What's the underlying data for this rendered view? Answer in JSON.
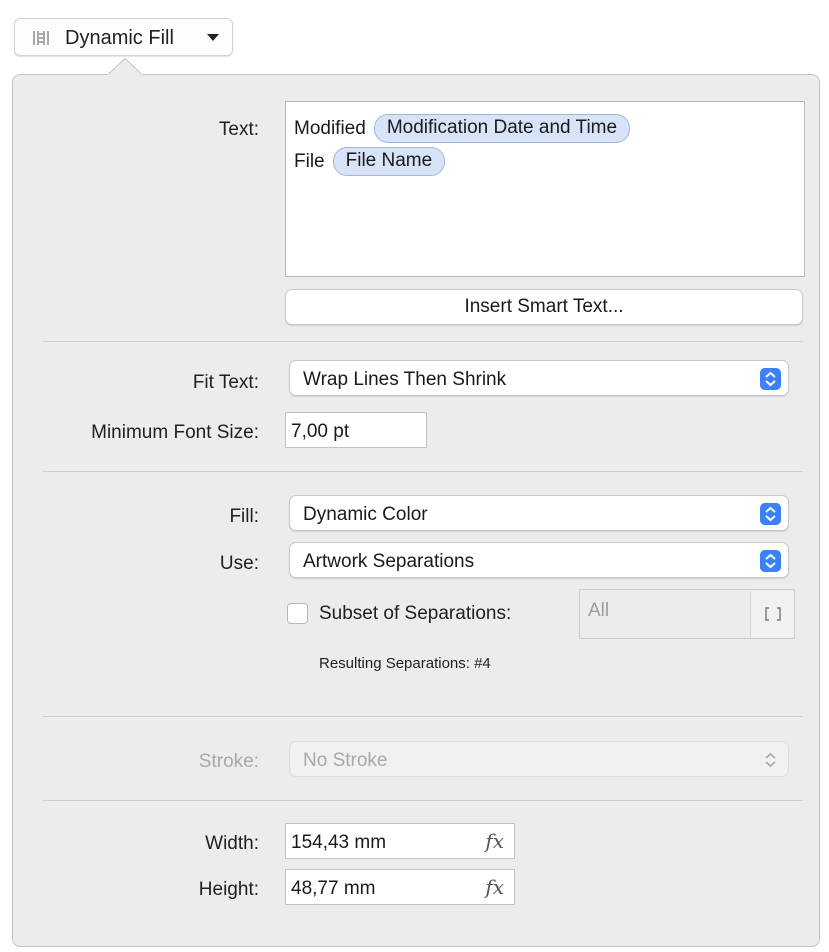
{
  "header": {
    "button_label": "Dynamic Fill",
    "button_icon": "dynamic-fill-grid-icon"
  },
  "text_section": {
    "label": "Text:",
    "lines": [
      {
        "prefix": "Modified",
        "token": "Modification Date and Time"
      },
      {
        "prefix": "File",
        "token": "File Name"
      }
    ],
    "insert_button": "Insert Smart Text..."
  },
  "fit_section": {
    "fit_label": "Fit Text:",
    "fit_value": "Wrap Lines Then Shrink",
    "min_font_label": "Minimum Font Size:",
    "min_font_value": "7,00 pt"
  },
  "fill_section": {
    "fill_label": "Fill:",
    "fill_value": "Dynamic Color",
    "use_label": "Use:",
    "use_value": "Artwork Separations",
    "subset_label": "Subset of Separations:",
    "subset_checked": false,
    "subset_placeholder": "All",
    "subset_icon": "brackets-icon",
    "resulting_text": "Resulting Separations: #4"
  },
  "stroke_section": {
    "label": "Stroke:",
    "value": "No Stroke",
    "enabled": false
  },
  "size_section": {
    "width_label": "Width:",
    "width_value": "154,43 mm",
    "height_label": "Height:",
    "height_value": "48,77 mm",
    "formula_symbol": "fx"
  },
  "colors": {
    "panel_bg": "#ececec",
    "token_bg": "#d7e4f8",
    "accent": "#3b82f6"
  }
}
